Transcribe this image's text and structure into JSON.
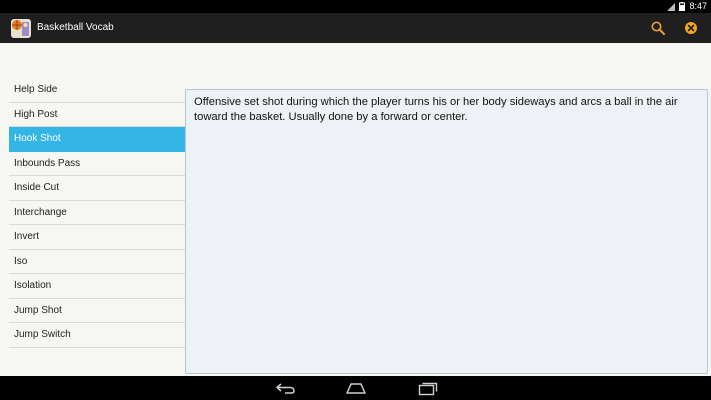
{
  "status": {
    "time": "8:47"
  },
  "app": {
    "title": "Basketball Vocab"
  },
  "icons": {
    "app": "basketball-app-icon",
    "search": "search-icon",
    "close": "close-icon",
    "back": "back-icon",
    "home": "home-icon",
    "recents": "recents-icon"
  },
  "colors": {
    "accent": "#33b5e5",
    "action_bar": "#1f1f1f",
    "search_icon": "#f0a030",
    "close_icon": "#f5a623"
  },
  "terms": [
    {
      "label": "Help Side",
      "selected": false
    },
    {
      "label": "High Post",
      "selected": false
    },
    {
      "label": "Hook Shot",
      "selected": true
    },
    {
      "label": "Inbounds Pass",
      "selected": false
    },
    {
      "label": "Inside Cut",
      "selected": false
    },
    {
      "label": "Interchange",
      "selected": false
    },
    {
      "label": "Invert",
      "selected": false
    },
    {
      "label": "Iso",
      "selected": false
    },
    {
      "label": "Isolation",
      "selected": false
    },
    {
      "label": "Jump Shot",
      "selected": false
    },
    {
      "label": "Jump Switch",
      "selected": false
    }
  ],
  "definition": {
    "text": "Offensive set shot during which the player turns his or her body sideways and arcs a ball in the air toward the basket. Usually done by a forward or center."
  }
}
